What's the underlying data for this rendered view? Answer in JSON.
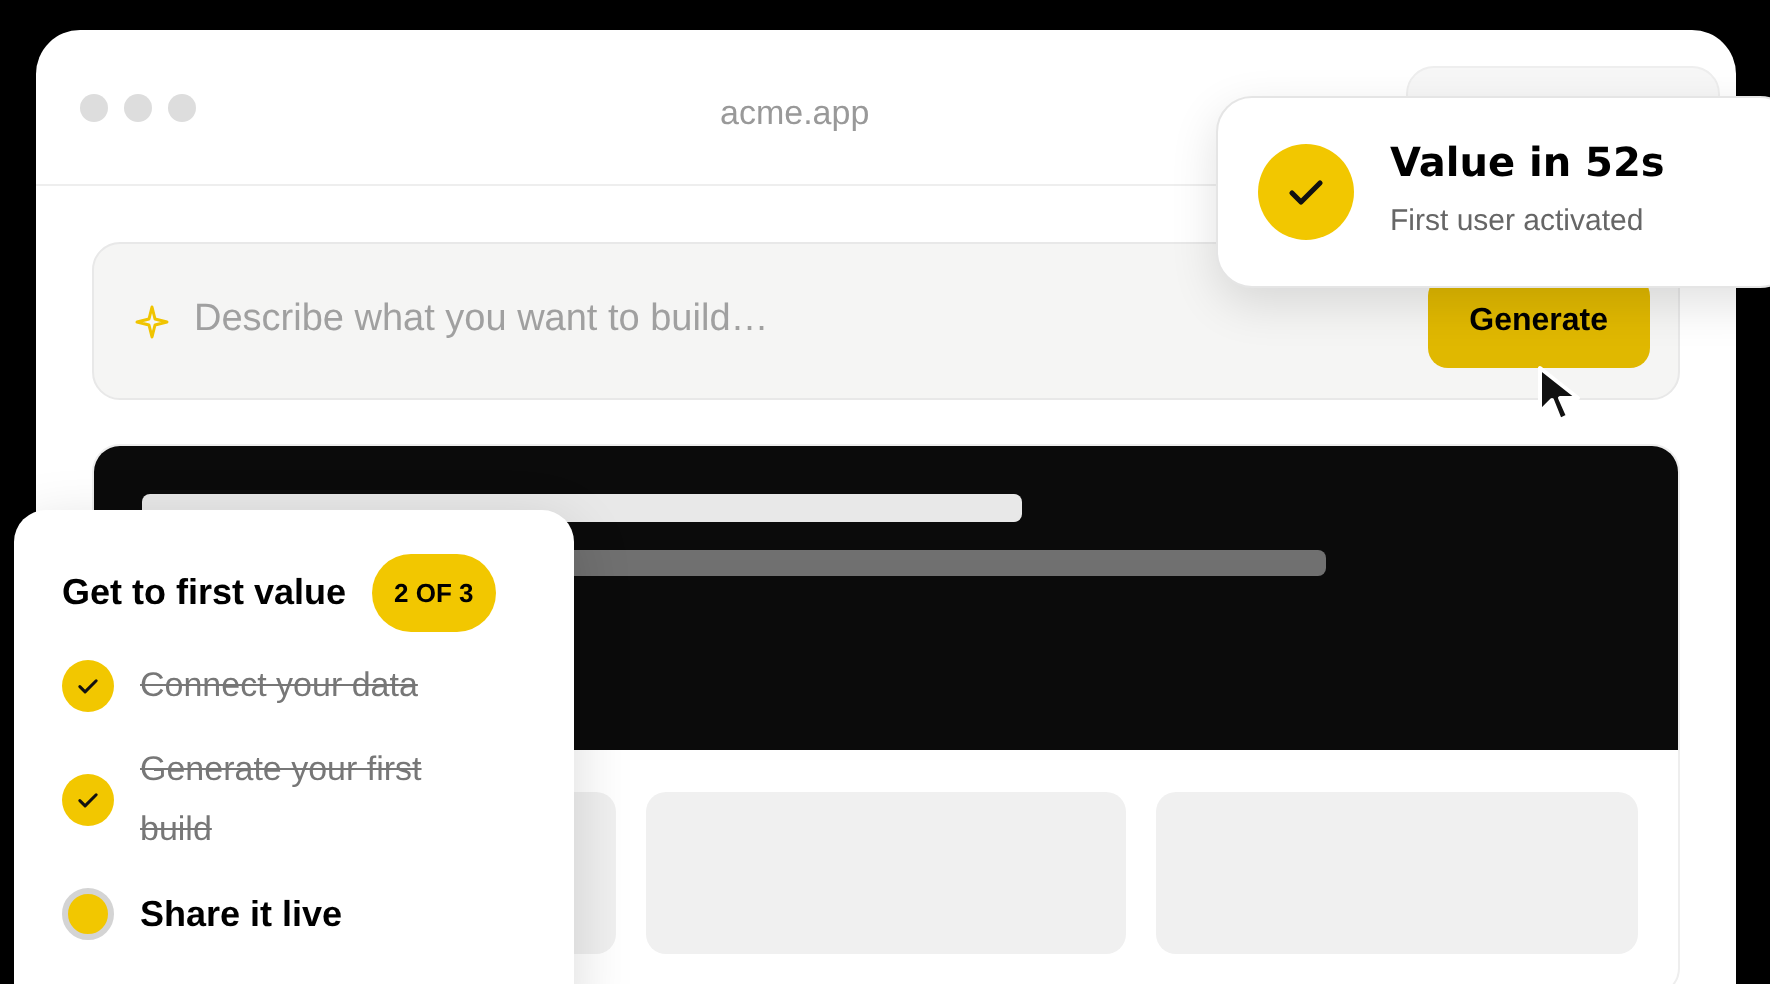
{
  "window": {
    "address": "acme.app"
  },
  "prompt": {
    "placeholder": "Describe what you want to build…",
    "button": "Generate"
  },
  "toast": {
    "title": "Value in 52s",
    "subtitle": "First user activated"
  },
  "checklist": {
    "title": "Get to first value",
    "badge": "2 OF 3",
    "items": [
      {
        "label": "Connect your data",
        "done": true
      },
      {
        "label": "Generate your first build",
        "done": true
      },
      {
        "label": "Share it live",
        "done": false
      }
    ]
  }
}
